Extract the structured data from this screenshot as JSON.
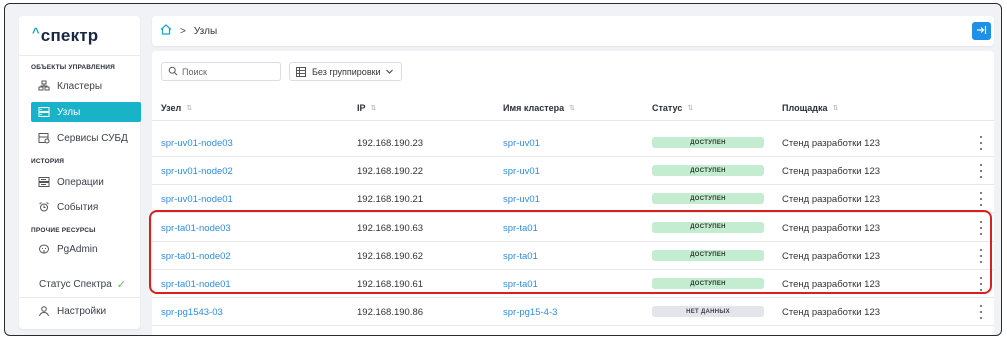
{
  "brand": {
    "caret": "^",
    "name": "спектр"
  },
  "sidebar": {
    "sections": [
      {
        "label": "ОБЪЕКТЫ УПРАВЛЕНИЯ"
      },
      {
        "label": "ИСТОРИЯ"
      },
      {
        "label": "ПРОЧИЕ РЕСУРСЫ"
      }
    ],
    "items": [
      {
        "label": "Кластеры",
        "icon": "cluster-icon"
      },
      {
        "label": "Узлы",
        "icon": "server-icon",
        "active": true
      },
      {
        "label": "Сервисы СУБД",
        "icon": "database-service-icon"
      },
      {
        "label": "Операции",
        "icon": "operations-icon"
      },
      {
        "label": "События",
        "icon": "events-icon"
      },
      {
        "label": "PgAdmin",
        "icon": "pgadmin-icon"
      }
    ],
    "status": {
      "label": "Статус Спектра",
      "icon": "check-icon"
    },
    "settings": {
      "label": "Настройки",
      "icon": "user-icon"
    }
  },
  "header": {
    "home_icon": "home-icon",
    "breadcrumb": "Узлы",
    "exit_icon": "logout-icon"
  },
  "toolbar": {
    "search_placeholder": "Поиск",
    "group_label": "Без группировки"
  },
  "table": {
    "columns": [
      "Узел",
      "IP",
      "Имя кластера",
      "Статус",
      "Площадка"
    ],
    "rows": [
      {
        "node": "spr-uv01-node03",
        "ip": "192.168.190.23",
        "cluster": "spr-uv01",
        "status": "ДОСТУПЕН",
        "status_kind": "ok",
        "site": "Стенд разработки 123"
      },
      {
        "node": "spr-uv01-node02",
        "ip": "192.168.190.22",
        "cluster": "spr-uv01",
        "status": "ДОСТУПЕН",
        "status_kind": "ok",
        "site": "Стенд разработки 123"
      },
      {
        "node": "spr-uv01-node01",
        "ip": "192.168.190.21",
        "cluster": "spr-uv01",
        "status": "ДОСТУПЕН",
        "status_kind": "ok",
        "site": "Стенд разработки 123"
      },
      {
        "node": "spr-ta01-node03",
        "ip": "192.168.190.63",
        "cluster": "spr-ta01",
        "status": "ДОСТУПЕН",
        "status_kind": "ok",
        "site": "Стенд разработки 123"
      },
      {
        "node": "spr-ta01-node02",
        "ip": "192.168.190.62",
        "cluster": "spr-ta01",
        "status": "ДОСТУПЕН",
        "status_kind": "ok",
        "site": "Стенд разработки 123"
      },
      {
        "node": "spr-ta01-node01",
        "ip": "192.168.190.61",
        "cluster": "spr-ta01",
        "status": "ДОСТУПЕН",
        "status_kind": "ok",
        "site": "Стенд разработки 123"
      },
      {
        "node": "spr-pg1543-03",
        "ip": "192.168.190.86",
        "cluster": "spr-pg15-4-3",
        "status": "НЕТ ДАННЫХ",
        "status_kind": "nodata",
        "site": "Стенд разработки 123"
      }
    ]
  },
  "colors": {
    "accent": "#18b3c8",
    "link": "#2f8de0",
    "status_ok_bg": "#c3ecd1",
    "status_nodata_bg": "#e3e5ea",
    "highlight": "#d92020",
    "button": "#1e90e8"
  }
}
